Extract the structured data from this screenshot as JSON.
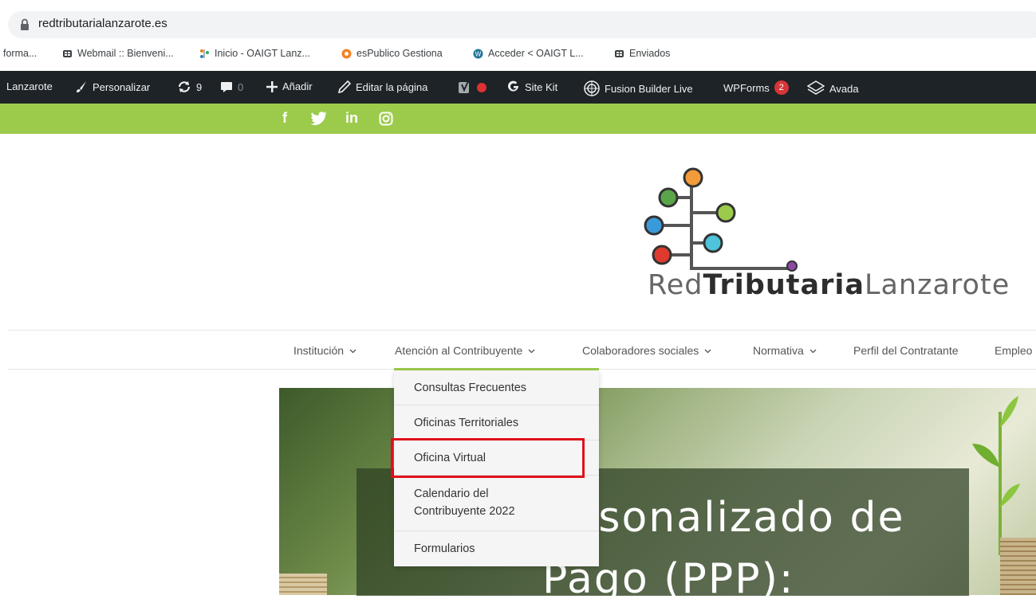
{
  "browser": {
    "url": "redtributarialanzarote.es",
    "bookmarks": [
      "forma...",
      "Webmail :: Bienveni...",
      "Inicio - OAIGT Lanz...",
      "esPublico Gestiona",
      "Acceder < OAIGT L...",
      "Enviados"
    ]
  },
  "admin_bar": {
    "site": "Lanzarote",
    "customize": "Personalizar",
    "updates": "9",
    "comments": "0",
    "add_new": "Añadir",
    "edit_page": "Editar la página",
    "site_kit": "Site Kit",
    "fusion": "Fusion Builder Live",
    "wpforms": "WPForms",
    "wpforms_count": "2",
    "avada": "Avada"
  },
  "social": [
    "f",
    "in"
  ],
  "logo": {
    "part1": "Red",
    "part2": "Tributaria",
    "part3": "Lanzarote"
  },
  "nav": {
    "items": [
      "Institución",
      "Atención al Contribuyente",
      "Colaboradores sociales",
      "Normativa",
      "Perfil del Contratante",
      "Empleo"
    ]
  },
  "dropdown": {
    "items": [
      "Consultas Frecuentes",
      "Oficinas Territoriales",
      "Oficina Virtual",
      "Calendario del",
      "Contribuyente 2022",
      "Formularios"
    ]
  },
  "hero": {
    "line1": "rsonalizado de",
    "line2": "Pago (PPP):"
  },
  "colors": {
    "green": "#9ccb4c",
    "admin_bg": "#1d2327",
    "highlight": "#e0101a"
  }
}
